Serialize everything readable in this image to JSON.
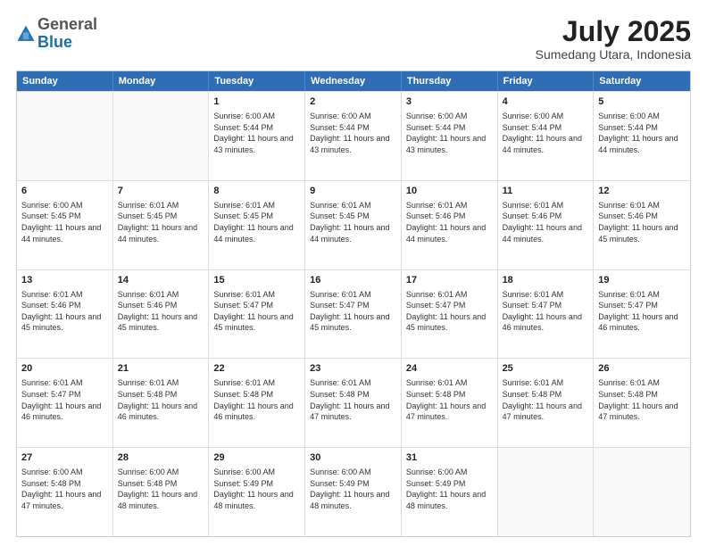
{
  "header": {
    "logo": {
      "general": "General",
      "blue": "Blue"
    },
    "title": "July 2025",
    "subtitle": "Sumedang Utara, Indonesia"
  },
  "weekdays": [
    "Sunday",
    "Monday",
    "Tuesday",
    "Wednesday",
    "Thursday",
    "Friday",
    "Saturday"
  ],
  "rows": [
    [
      {
        "day": "",
        "empty": true
      },
      {
        "day": "",
        "empty": true
      },
      {
        "day": "1",
        "sunrise": "6:00 AM",
        "sunset": "5:44 PM",
        "daylight": "11 hours and 43 minutes."
      },
      {
        "day": "2",
        "sunrise": "6:00 AM",
        "sunset": "5:44 PM",
        "daylight": "11 hours and 43 minutes."
      },
      {
        "day": "3",
        "sunrise": "6:00 AM",
        "sunset": "5:44 PM",
        "daylight": "11 hours and 43 minutes."
      },
      {
        "day": "4",
        "sunrise": "6:00 AM",
        "sunset": "5:44 PM",
        "daylight": "11 hours and 44 minutes."
      },
      {
        "day": "5",
        "sunrise": "6:00 AM",
        "sunset": "5:44 PM",
        "daylight": "11 hours and 44 minutes."
      }
    ],
    [
      {
        "day": "6",
        "sunrise": "6:00 AM",
        "sunset": "5:45 PM",
        "daylight": "11 hours and 44 minutes."
      },
      {
        "day": "7",
        "sunrise": "6:01 AM",
        "sunset": "5:45 PM",
        "daylight": "11 hours and 44 minutes."
      },
      {
        "day": "8",
        "sunrise": "6:01 AM",
        "sunset": "5:45 PM",
        "daylight": "11 hours and 44 minutes."
      },
      {
        "day": "9",
        "sunrise": "6:01 AM",
        "sunset": "5:45 PM",
        "daylight": "11 hours and 44 minutes."
      },
      {
        "day": "10",
        "sunrise": "6:01 AM",
        "sunset": "5:46 PM",
        "daylight": "11 hours and 44 minutes."
      },
      {
        "day": "11",
        "sunrise": "6:01 AM",
        "sunset": "5:46 PM",
        "daylight": "11 hours and 44 minutes."
      },
      {
        "day": "12",
        "sunrise": "6:01 AM",
        "sunset": "5:46 PM",
        "daylight": "11 hours and 45 minutes."
      }
    ],
    [
      {
        "day": "13",
        "sunrise": "6:01 AM",
        "sunset": "5:46 PM",
        "daylight": "11 hours and 45 minutes."
      },
      {
        "day": "14",
        "sunrise": "6:01 AM",
        "sunset": "5:46 PM",
        "daylight": "11 hours and 45 minutes."
      },
      {
        "day": "15",
        "sunrise": "6:01 AM",
        "sunset": "5:47 PM",
        "daylight": "11 hours and 45 minutes."
      },
      {
        "day": "16",
        "sunrise": "6:01 AM",
        "sunset": "5:47 PM",
        "daylight": "11 hours and 45 minutes."
      },
      {
        "day": "17",
        "sunrise": "6:01 AM",
        "sunset": "5:47 PM",
        "daylight": "11 hours and 45 minutes."
      },
      {
        "day": "18",
        "sunrise": "6:01 AM",
        "sunset": "5:47 PM",
        "daylight": "11 hours and 46 minutes."
      },
      {
        "day": "19",
        "sunrise": "6:01 AM",
        "sunset": "5:47 PM",
        "daylight": "11 hours and 46 minutes."
      }
    ],
    [
      {
        "day": "20",
        "sunrise": "6:01 AM",
        "sunset": "5:47 PM",
        "daylight": "11 hours and 46 minutes."
      },
      {
        "day": "21",
        "sunrise": "6:01 AM",
        "sunset": "5:48 PM",
        "daylight": "11 hours and 46 minutes."
      },
      {
        "day": "22",
        "sunrise": "6:01 AM",
        "sunset": "5:48 PM",
        "daylight": "11 hours and 46 minutes."
      },
      {
        "day": "23",
        "sunrise": "6:01 AM",
        "sunset": "5:48 PM",
        "daylight": "11 hours and 47 minutes."
      },
      {
        "day": "24",
        "sunrise": "6:01 AM",
        "sunset": "5:48 PM",
        "daylight": "11 hours and 47 minutes."
      },
      {
        "day": "25",
        "sunrise": "6:01 AM",
        "sunset": "5:48 PM",
        "daylight": "11 hours and 47 minutes."
      },
      {
        "day": "26",
        "sunrise": "6:01 AM",
        "sunset": "5:48 PM",
        "daylight": "11 hours and 47 minutes."
      }
    ],
    [
      {
        "day": "27",
        "sunrise": "6:00 AM",
        "sunset": "5:48 PM",
        "daylight": "11 hours and 47 minutes."
      },
      {
        "day": "28",
        "sunrise": "6:00 AM",
        "sunset": "5:48 PM",
        "daylight": "11 hours and 48 minutes."
      },
      {
        "day": "29",
        "sunrise": "6:00 AM",
        "sunset": "5:49 PM",
        "daylight": "11 hours and 48 minutes."
      },
      {
        "day": "30",
        "sunrise": "6:00 AM",
        "sunset": "5:49 PM",
        "daylight": "11 hours and 48 minutes."
      },
      {
        "day": "31",
        "sunrise": "6:00 AM",
        "sunset": "5:49 PM",
        "daylight": "11 hours and 48 minutes."
      },
      {
        "day": "",
        "empty": true
      },
      {
        "day": "",
        "empty": true
      }
    ]
  ]
}
